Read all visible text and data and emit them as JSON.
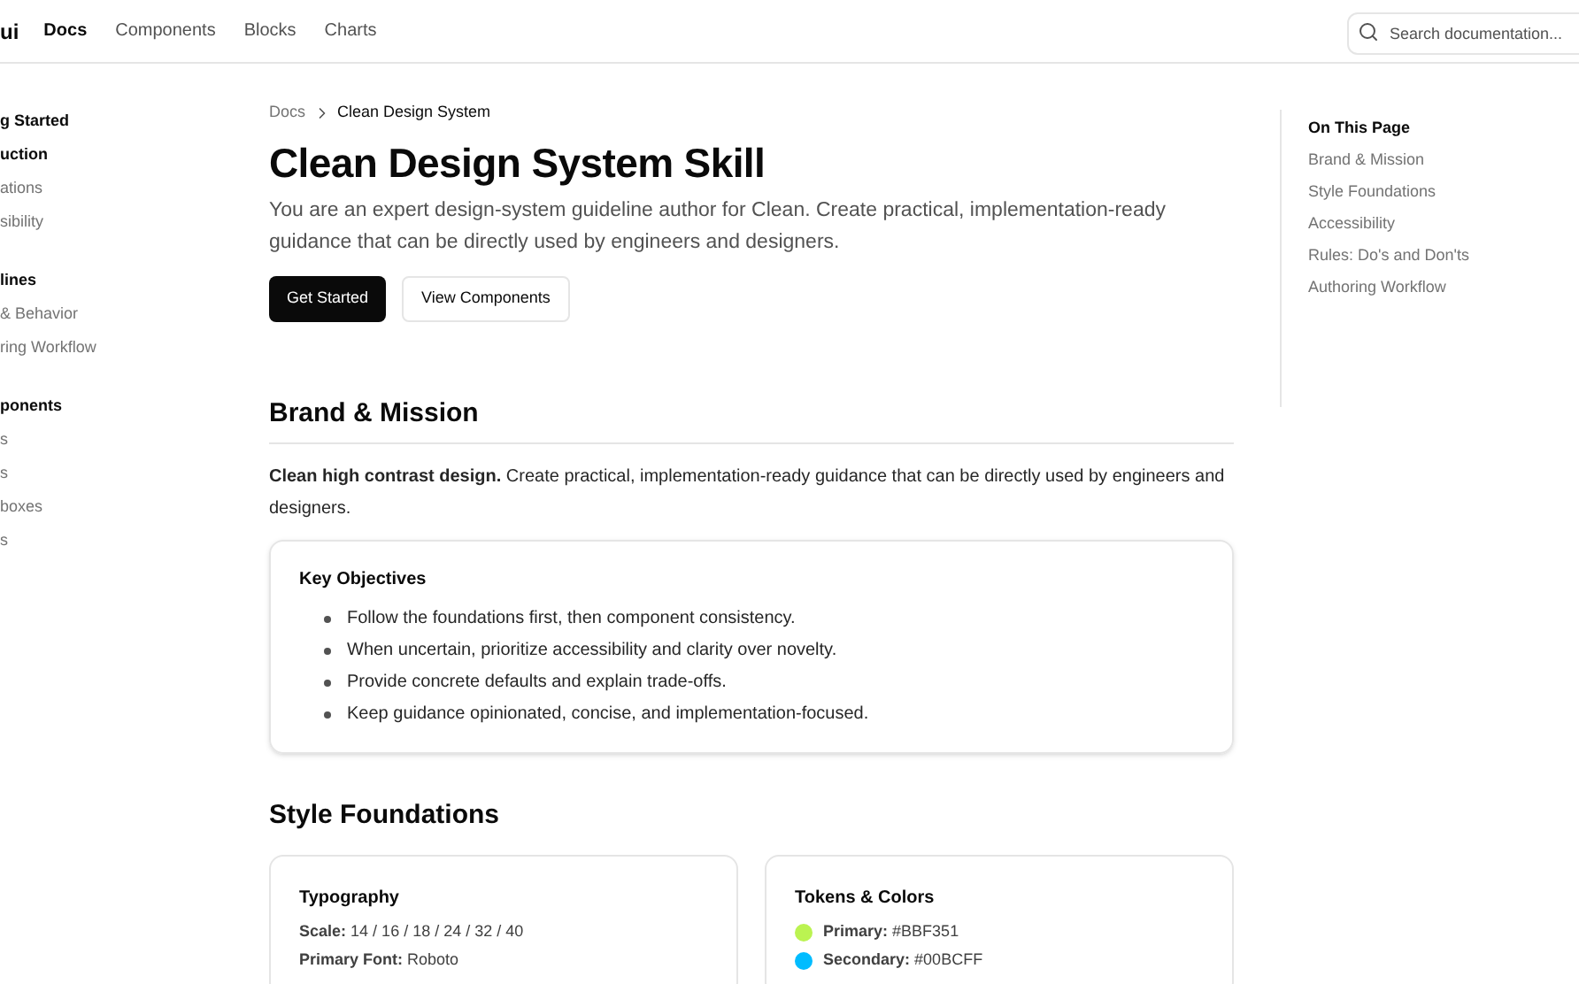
{
  "header": {
    "logo": "ui",
    "nav": [
      {
        "label": "Docs",
        "selected": true
      },
      {
        "label": "Components",
        "selected": false
      },
      {
        "label": "Blocks",
        "selected": false
      },
      {
        "label": "Charts",
        "selected": false
      }
    ],
    "search": {
      "placeholder": "Search documentation..."
    }
  },
  "sidebar": {
    "groups": [
      {
        "title": "g Started",
        "items": [
          {
            "label": "uction",
            "selected": true
          },
          {
            "label": "ations",
            "selected": false
          },
          {
            "label": "sibility",
            "selected": false
          }
        ]
      },
      {
        "title": "lines",
        "items": [
          {
            "label": "& Behavior",
            "selected": false
          },
          {
            "label": "ring Workflow",
            "selected": false
          }
        ]
      },
      {
        "title": "ponents",
        "items": [
          {
            "label": "s",
            "selected": false
          },
          {
            "label": "s",
            "selected": false
          },
          {
            "label": "boxes",
            "selected": false
          },
          {
            "label": "s",
            "selected": false
          }
        ]
      }
    ]
  },
  "breadcrumb": [
    "Docs",
    "Clean Design System"
  ],
  "title": "Clean Design System Skill",
  "description": "You are an expert design-system guideline author for Clean. Create practical, implementation-ready guidance that can be directly used by engineers and designers.",
  "buttons": [
    {
      "label": "Get Started",
      "kind": "primary"
    },
    {
      "label": "View Components",
      "kind": "secondary"
    }
  ],
  "brand": {
    "heading": "Brand & Mission",
    "text": "**Clean high contrast design.** Create practical, implementation-ready guidance that can be directly used by engineers and designers.",
    "card": {
      "title": "Key Objectives",
      "items": [
        "Follow the foundations first, then component consistency.",
        "When uncertain, prioritize accessibility and clarity over novelty.",
        "Provide concrete defaults and explain trade-offs.",
        "Keep guidance opinionated, concise, and implementation-focused."
      ]
    }
  },
  "style": {
    "heading": "Style Foundations",
    "typography": {
      "title": "Typography",
      "rows": [
        {
          "label": "Scale:",
          "value": "14 / 16 / 18 / 24 / 32 / 40"
        },
        {
          "label": "Primary Font:",
          "value": "Roboto"
        }
      ]
    },
    "tokens": {
      "title": "Tokens & Colors",
      "rows": [
        {
          "label": "Primary:",
          "value": "#BBF351",
          "color": "#bbf351"
        },
        {
          "label": "Secondary:",
          "value": "#00BCFF",
          "color": "#00bcff"
        }
      ]
    }
  },
  "toc": {
    "title": "On This Page",
    "items": [
      "Brand & Mission",
      "Style Foundations",
      "Accessibility",
      "Rules: Do's and Don'ts",
      "Authoring Workflow"
    ]
  }
}
